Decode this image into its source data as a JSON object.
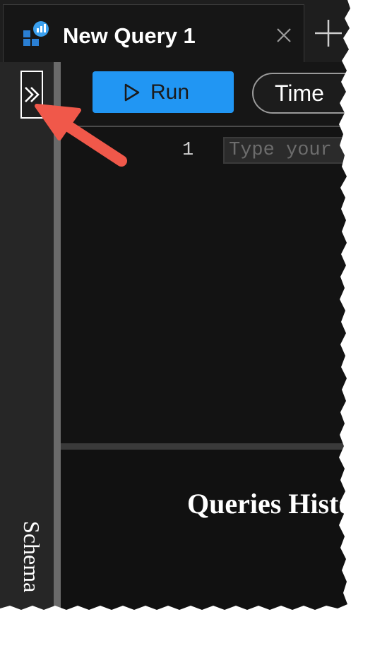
{
  "tab": {
    "title": "New Query 1",
    "icon": "query-editor-icon",
    "close_icon": "close-icon",
    "new_tab_icon": "plus-icon"
  },
  "sidebar": {
    "expand_icon": "chevrons-right-icon",
    "schema_label": "Schema"
  },
  "toolbar": {
    "run_label": "Run",
    "run_icon": "play-icon",
    "time_label": "Time"
  },
  "editor": {
    "line_number": "1",
    "placeholder": "Type your"
  },
  "history": {
    "title": "Queries History"
  },
  "colors": {
    "accent": "#2196f3",
    "annotation_arrow": "#f0584a",
    "background": "#171717"
  }
}
